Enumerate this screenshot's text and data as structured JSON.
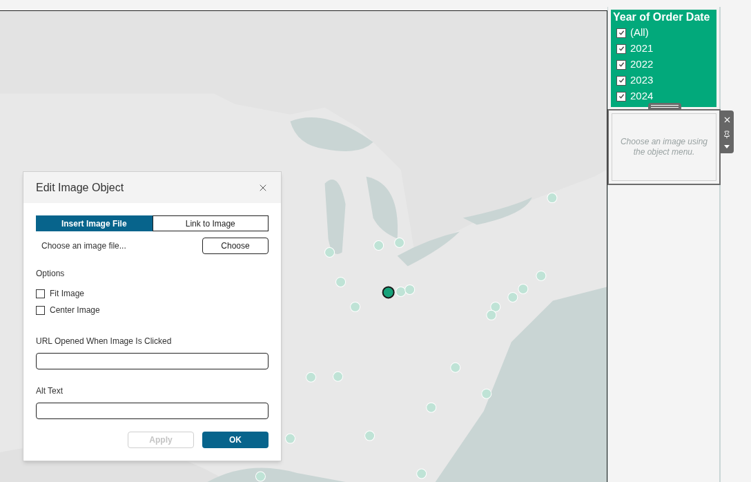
{
  "filter_card": {
    "title": "Year of Order Date",
    "items": [
      {
        "label": "(All)",
        "checked": true
      },
      {
        "label": "2021",
        "checked": true
      },
      {
        "label": "2022",
        "checked": true
      },
      {
        "label": "2023",
        "checked": true
      },
      {
        "label": "2024",
        "checked": true
      }
    ]
  },
  "image_object": {
    "hint": "Choose an image using the object menu."
  },
  "dialog": {
    "title": "Edit Image Object",
    "tabs": [
      {
        "label": "Insert Image File",
        "selected": true
      },
      {
        "label": "Link to Image",
        "selected": false
      }
    ],
    "file_prompt": "Choose an image file...",
    "choose_button": "Choose",
    "options_label": "Options",
    "options": [
      {
        "label": "Fit Image",
        "checked": false
      },
      {
        "label": "Center Image",
        "checked": false
      }
    ],
    "url_label": "URL Opened When Image Is Clicked",
    "alt_label": "Alt Text",
    "buttons": [
      {
        "label": "Apply",
        "disabled": true
      },
      {
        "label": "OK",
        "disabled": false
      }
    ]
  }
}
